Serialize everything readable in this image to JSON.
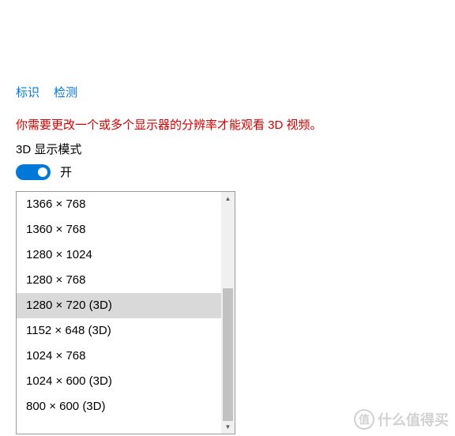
{
  "links": {
    "identify": "标识",
    "detect": "检测"
  },
  "warning_text": "你需要更改一个或多个显示器的分辨率才能观看 3D 视频。",
  "mode_label": "3D 显示模式",
  "toggle": {
    "state_label": "开"
  },
  "resolutions": {
    "items": [
      {
        "label": "1366 × 768",
        "selected": false
      },
      {
        "label": "1360 × 768",
        "selected": false
      },
      {
        "label": "1280 × 1024",
        "selected": false
      },
      {
        "label": "1280 × 768",
        "selected": false
      },
      {
        "label": "1280 × 720 (3D)",
        "selected": true
      },
      {
        "label": "1152 × 648 (3D)",
        "selected": false
      },
      {
        "label": "1024 × 768",
        "selected": false
      },
      {
        "label": "1024 × 600 (3D)",
        "selected": false
      },
      {
        "label": "800 × 600 (3D)",
        "selected": false
      }
    ]
  },
  "watermark": {
    "icon_char": "值",
    "text": "什么值得买"
  }
}
